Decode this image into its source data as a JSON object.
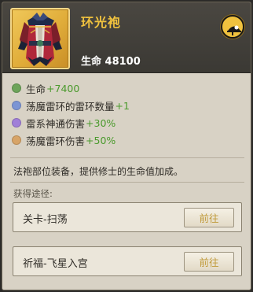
{
  "item": {
    "name": "环光袍",
    "stat_label": "生命",
    "stat_value": "48100",
    "corner_icon": "hat-icon"
  },
  "attributes": [
    {
      "label": "生命",
      "value": "+7400",
      "color": "#6da45a"
    },
    {
      "label": "荡魔雷环的雷环数量",
      "value": "+1",
      "color": "#7b95d4"
    },
    {
      "label": "雷系神通伤害",
      "value": "+30%",
      "color": "#a07fd8"
    },
    {
      "label": "荡魔雷环伤害",
      "value": "+50%",
      "color": "#d7a467"
    }
  ],
  "description": "法袍部位装备，提供修士的生命值加成。",
  "obtain": {
    "title": "获得途径:",
    "sources": [
      {
        "label": "关卡-扫荡",
        "button": "前往"
      },
      {
        "label": "祈福-飞星入宫",
        "button": "前往"
      }
    ]
  },
  "colors": {
    "accent_gold": "#f0c23e",
    "value_green": "#4a9a2c",
    "button_text": "#c09a3a"
  }
}
